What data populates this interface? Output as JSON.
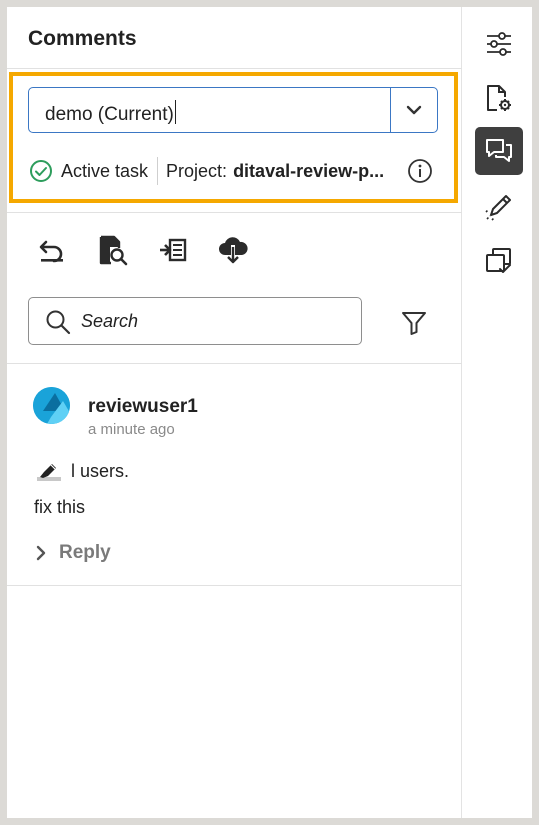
{
  "panel": {
    "title": "Comments"
  },
  "version_select": {
    "value": "demo (Current)"
  },
  "task_status": {
    "label": "Active task",
    "project_label": "Project:",
    "project_value": "ditaval-review-p..."
  },
  "toolbar": {
    "icons": [
      "undo-icon",
      "document-search-icon",
      "import-icon",
      "cloud-download-icon"
    ]
  },
  "search": {
    "placeholder": "Search"
  },
  "comments": [
    {
      "user": "reviewuser1",
      "time": "a minute ago",
      "annotation_text": "l users.",
      "body": "fix this",
      "reply_label": "Reply"
    }
  ],
  "rail": {
    "items": [
      "settings-sliders-icon",
      "file-settings-icon",
      "comments-icon",
      "edit-icon",
      "copy-check-icon"
    ],
    "active": "comments-icon"
  },
  "colors": {
    "highlight": "#f5a800",
    "focus_border": "#3b77c4",
    "active_task": "#2d9d5c",
    "avatar": "#1aa3d9",
    "rail_active_bg": "#3f3f3f"
  }
}
